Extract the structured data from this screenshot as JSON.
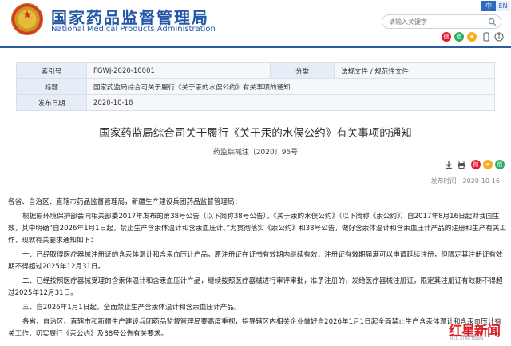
{
  "header": {
    "site_title": "国家药品监督管理局",
    "site_subtitle": "National Medical Products Administration",
    "lang_zh": "中",
    "lang_en": "EN",
    "search_placeholder": "请输入关键字"
  },
  "meta": {
    "rows": [
      {
        "key1": "索引号",
        "val1": "FGWJ-2020-10001",
        "key2": "分类",
        "val2": "法规文件 / 规范性文件"
      },
      {
        "key1": "标题",
        "val1": "国家药监局综合司关于履行《关于汞的水俣公约》有关事项的通知"
      },
      {
        "key1": "发布日期",
        "val1": "2020-10-16"
      }
    ]
  },
  "document": {
    "title": "国家药监局综合司关于履行《关于汞的水俣公约》有关事项的通知",
    "number": "药监综械注〔2020〕95号",
    "publish_time": "发布时间：2020-10-16",
    "paragraphs": [
      "各省、自治区、直辖市药品监督管理局，新疆生产建设兵团药品监督管理局：",
      "根据原环境保护部会同相关部委2017年发布的第38号公告（以下简称38号公告），《关于汞的水俣公约》（以下简称《汞公约》）自2017年8月16日起对我国生效，其中明确“自2026年1月1日起，禁止生产含汞体温计和含汞血压计。”为贯彻落实《汞公约》和38号公告，做好含汞体温计和含汞血压计产品的注册和生产有关工作，现就有关要求通知如下：",
      "一、已经取得医疗器械注册证的含汞体温计和含汞血压计产品，原注册证在证书有效期内继续有效；注册证有效期届满可以申请延续注册，但限定其注册证有效期不得超过2025年12月31日。",
      "二、已经按照医疗器械受理的含汞体温计和含汞血压计产品，继续按照医疗器械进行审评审批，准予注册的，发给医疗器械注册证，限定其注册证有效期不得超过2025年12月31日。",
      "三、自2026年1月1日起，全面禁止生产含汞体温计和含汞血压计产品。",
      "各省、自治区、直辖市和新疆生产建设兵团药品监督管理局要高度重视，指导辖区内相关企业做好自2026年1月1日起全面禁止生产含汞体温计和含汞血压计有关工作，切实履行《汞公约》及38号公告有关要求。"
    ]
  },
  "icons": {
    "weibo": "weibo-icon",
    "wechat": "wechat-icon",
    "qzone": "qzone-icon",
    "print": "print-icon",
    "download": "download-icon",
    "favorite": "favorite-icon"
  },
  "watermark": {
    "main": "红星新闻",
    "sub": "RED STAR NEWS"
  },
  "colors": {
    "brand_blue": "#2457a6",
    "accent_red": "#d81f26",
    "table_key_bg": "#e7edf6"
  }
}
